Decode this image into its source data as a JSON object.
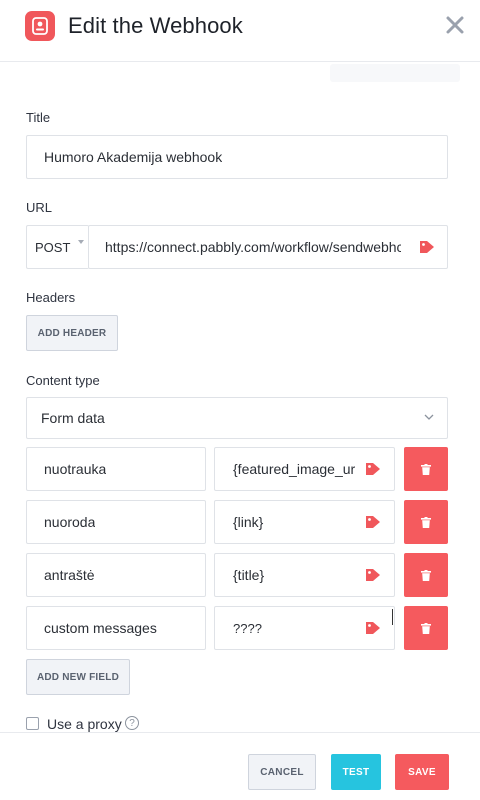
{
  "header": {
    "title": "Edit the Webhook"
  },
  "form": {
    "title_label": "Title",
    "title_value": "Humoro Akademija webhook",
    "url_label": "URL",
    "method": "POST",
    "url_value": "https://connect.pabbly.com/workflow/sendwebhc",
    "headers_label": "Headers",
    "add_header_label": "ADD HEADER",
    "content_type_label": "Content type",
    "content_type_value": "Form data",
    "fields": [
      {
        "key": "nuotrauka",
        "value": "{featured_image_ur"
      },
      {
        "key": "nuoroda",
        "value": "{link}"
      },
      {
        "key": "antraštė",
        "value": "{title}"
      },
      {
        "key": "custom messages",
        "value": "????"
      }
    ],
    "add_field_label": "ADD NEW FIELD",
    "proxy_label": "Use a proxy",
    "proxy_help": "?"
  },
  "footer": {
    "cancel_label": "CANCEL",
    "test_label": "TEST",
    "save_label": "SAVE"
  },
  "colors": {
    "accent_red": "#f55a5e",
    "accent_teal": "#26c4df",
    "tag_red": "#f0575b"
  }
}
